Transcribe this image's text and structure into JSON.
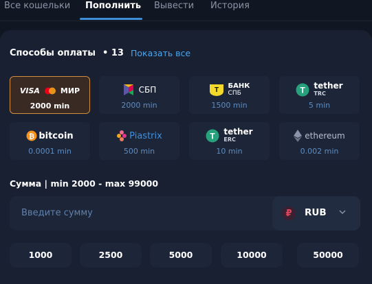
{
  "tabs": [
    {
      "label": "Все кошельки"
    },
    {
      "label": "Пополнить"
    },
    {
      "label": "Вывести"
    },
    {
      "label": "История"
    }
  ],
  "active_tab": "Пополнить",
  "payment_methods": {
    "title": "Способы оплаты",
    "count": "• 13",
    "show_all": "Показать все",
    "items": [
      {
        "logo_text": "VISA",
        "logo_text2": "МИР",
        "min": "2000 min",
        "selected": true
      },
      {
        "logo_text": "СБП",
        "min": "2000 min"
      },
      {
        "logo_text": "БАНК",
        "logo_text2": "СПБ",
        "min": "1500 min"
      },
      {
        "logo_text": "tether",
        "logo_text2": "TRC",
        "min": "5 min"
      },
      {
        "logo_text": "bitcoin",
        "min": "0.0001 min"
      },
      {
        "logo_text": "Piastrix",
        "min": "500 min"
      },
      {
        "logo_text": "tether",
        "logo_text2": "ERC",
        "min": "10 min"
      },
      {
        "logo_text": "ethereum",
        "min": "0.002 min"
      }
    ]
  },
  "amount": {
    "label": "Сумма | min 2000 - max 99000",
    "placeholder": "Введите сумму",
    "currency": "RUB",
    "currency_symbol": "₽"
  },
  "presets": [
    "1000",
    "2500",
    "5000",
    "10000",
    "50000"
  ],
  "colors": {
    "background": "#111722",
    "panel": "#182032",
    "accent": "#4aa6f0",
    "selected_border": "#d38f3e",
    "tether": "#26a17b",
    "bitcoin": "#f7931a",
    "bank_spb": "#f5d92a"
  }
}
